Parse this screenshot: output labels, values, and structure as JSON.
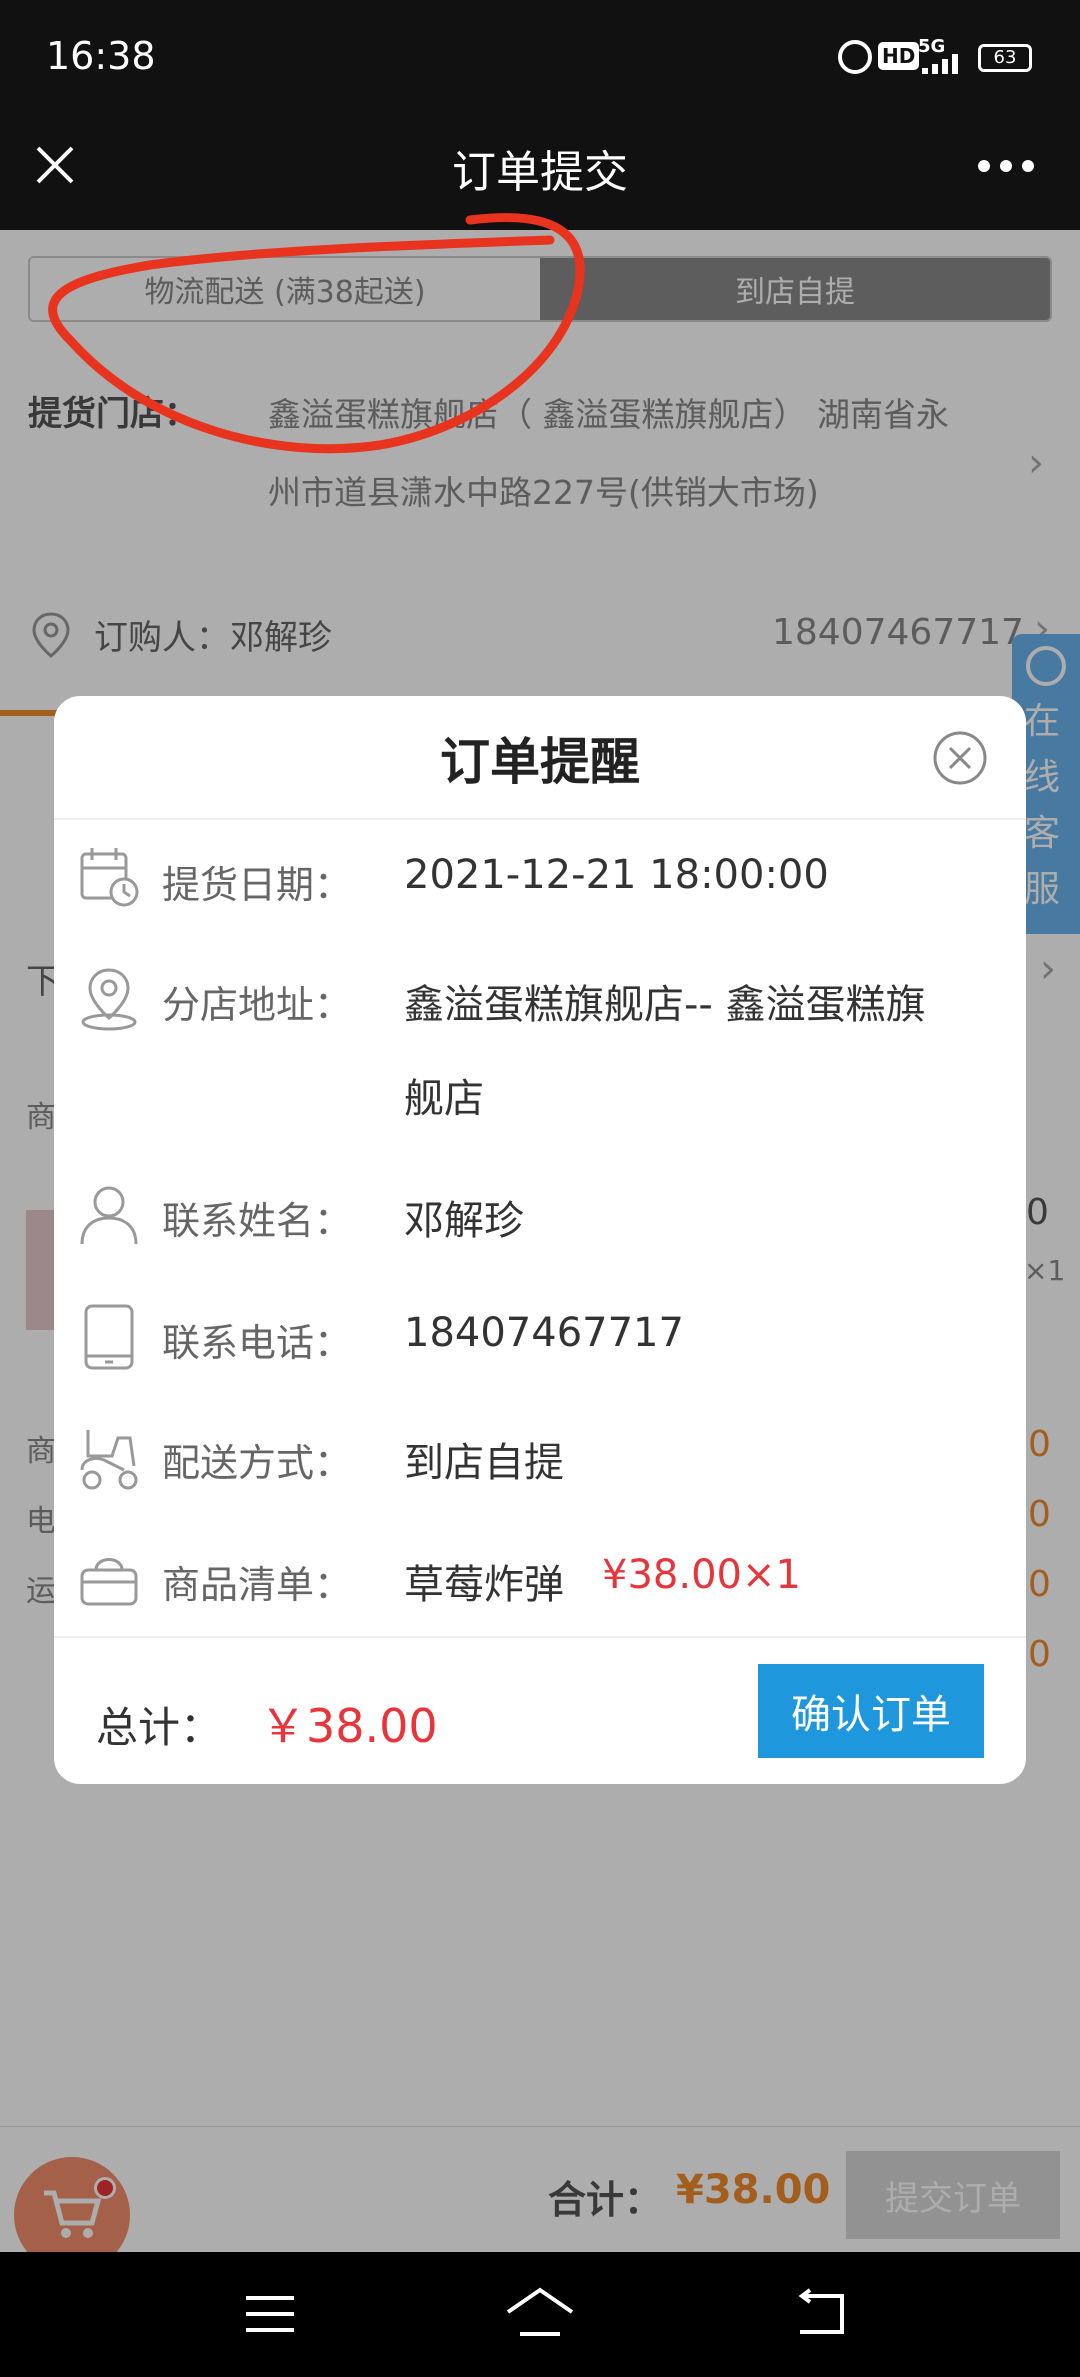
{
  "status_bar": {
    "time": "16:38",
    "network": "5G",
    "hd": "HD",
    "battery": "63"
  },
  "header": {
    "title": "订单提交"
  },
  "delivery_tabs": [
    {
      "label": "物流配送 (满38起送)"
    },
    {
      "label": "到店自提"
    }
  ],
  "pickup": {
    "label": "提货门店：",
    "address_line1": "鑫溢蛋糕旗舰店（ 鑫溢蛋糕旗舰店） 湖南省永",
    "address_line2": "州市道县潇水中路227号(供销大市场)"
  },
  "buyer": {
    "label": "订购人：邓解珍",
    "phone": "18407467717"
  },
  "side_service": {
    "text": "在线客服"
  },
  "bg_fragments": {
    "left": [
      "下",
      "商",
      "商",
      "电",
      "运"
    ],
    "right": [
      "0",
      "×1",
      "0",
      "0",
      "0",
      "0"
    ]
  },
  "modal": {
    "title": "订单提醒",
    "rows": [
      {
        "icon": "calendar-clock-icon",
        "label": "提货日期：",
        "value": "2021-12-21 18:00:00"
      },
      {
        "icon": "location-pin-icon",
        "label": "分店地址：",
        "value_line1": "鑫溢蛋糕旗舰店-- 鑫溢蛋糕旗",
        "value_line2": "舰店"
      },
      {
        "icon": "person-icon",
        "label": "联系姓名：",
        "value": "邓解珍"
      },
      {
        "icon": "tablet-icon",
        "label": "联系电话：",
        "value": "18407467717"
      },
      {
        "icon": "scooter-icon",
        "label": "配送方式：",
        "value": "到店自提"
      },
      {
        "icon": "basket-icon",
        "label": "商品清单：",
        "value": "草莓炸弹",
        "price": "¥38.00×1"
      }
    ],
    "total_label": "总计：",
    "total_value": "￥38.00",
    "confirm_label": "确认订单"
  },
  "footer": {
    "total_label": "合计：",
    "total_value": "¥38.00",
    "submit_label": "提交订单"
  },
  "colors": {
    "accent_blue": "#1e97dd",
    "price_red": "#e8343a",
    "orange": "#f08a2a"
  }
}
